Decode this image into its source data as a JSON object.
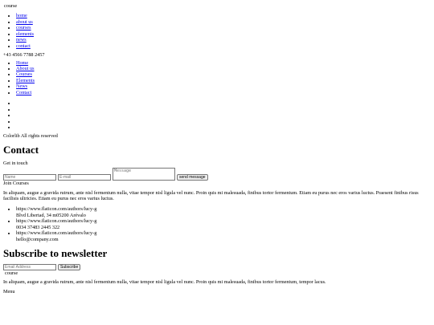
{
  "logo": "course",
  "nav_lower": [
    "home",
    "about us",
    "courses",
    "elements",
    "news",
    "contact"
  ],
  "phone": "+43 4566 7788 2457",
  "nav_upper": [
    "Home",
    "About us",
    "Courses",
    "Elements",
    "News",
    "Contact"
  ],
  "social_count": 5,
  "copyright": "Colorlib All rights reserved",
  "contact": {
    "title": "Contact",
    "subtitle": "Get in touch",
    "name_placeholder": "Name",
    "email_placeholder": "E-mail",
    "message_placeholder": "Message",
    "send_label": "send message"
  },
  "join": {
    "label": "Join Courses",
    "text": "In aliquam, augue a gravida rutrum, ante nisl fermentum nulla, vitae tempor nisl ligula vel nunc. Proin quis mi malesuada, finibus tortor fermentum. Etiam eu purus nec eros varius luctus. Praesent finibus risus facilisis ultricies. Etiam eu purus nec eros varius luctus."
  },
  "contact_info": [
    {
      "img_alt": "https://www.flaticon.com/authors/lucy-g",
      "text": "Blvd Libertad, 34 m05200 Arévalo"
    },
    {
      "img_alt": "https://www.flaticon.com/authors/lucy-g",
      "text": "0034 37483 2445 322"
    },
    {
      "img_alt": "https://www.flaticon.com/authors/lucy-g",
      "text": "hello@company.com"
    }
  ],
  "newsletter": {
    "title": "Subscribe to newsletter",
    "email_placeholder": "Email Address",
    "subscribe_label": "Subscribe"
  },
  "footer_logo": "course",
  "footer_text": "In aliquam, augue a gravida rutrum, ante nisl fermentum nulla, vitae tempor nisl ligula vel nunc. Proin quis mi malesuada, finibus tortor fermentum, tempor lacus.",
  "menu_label": "Menu"
}
